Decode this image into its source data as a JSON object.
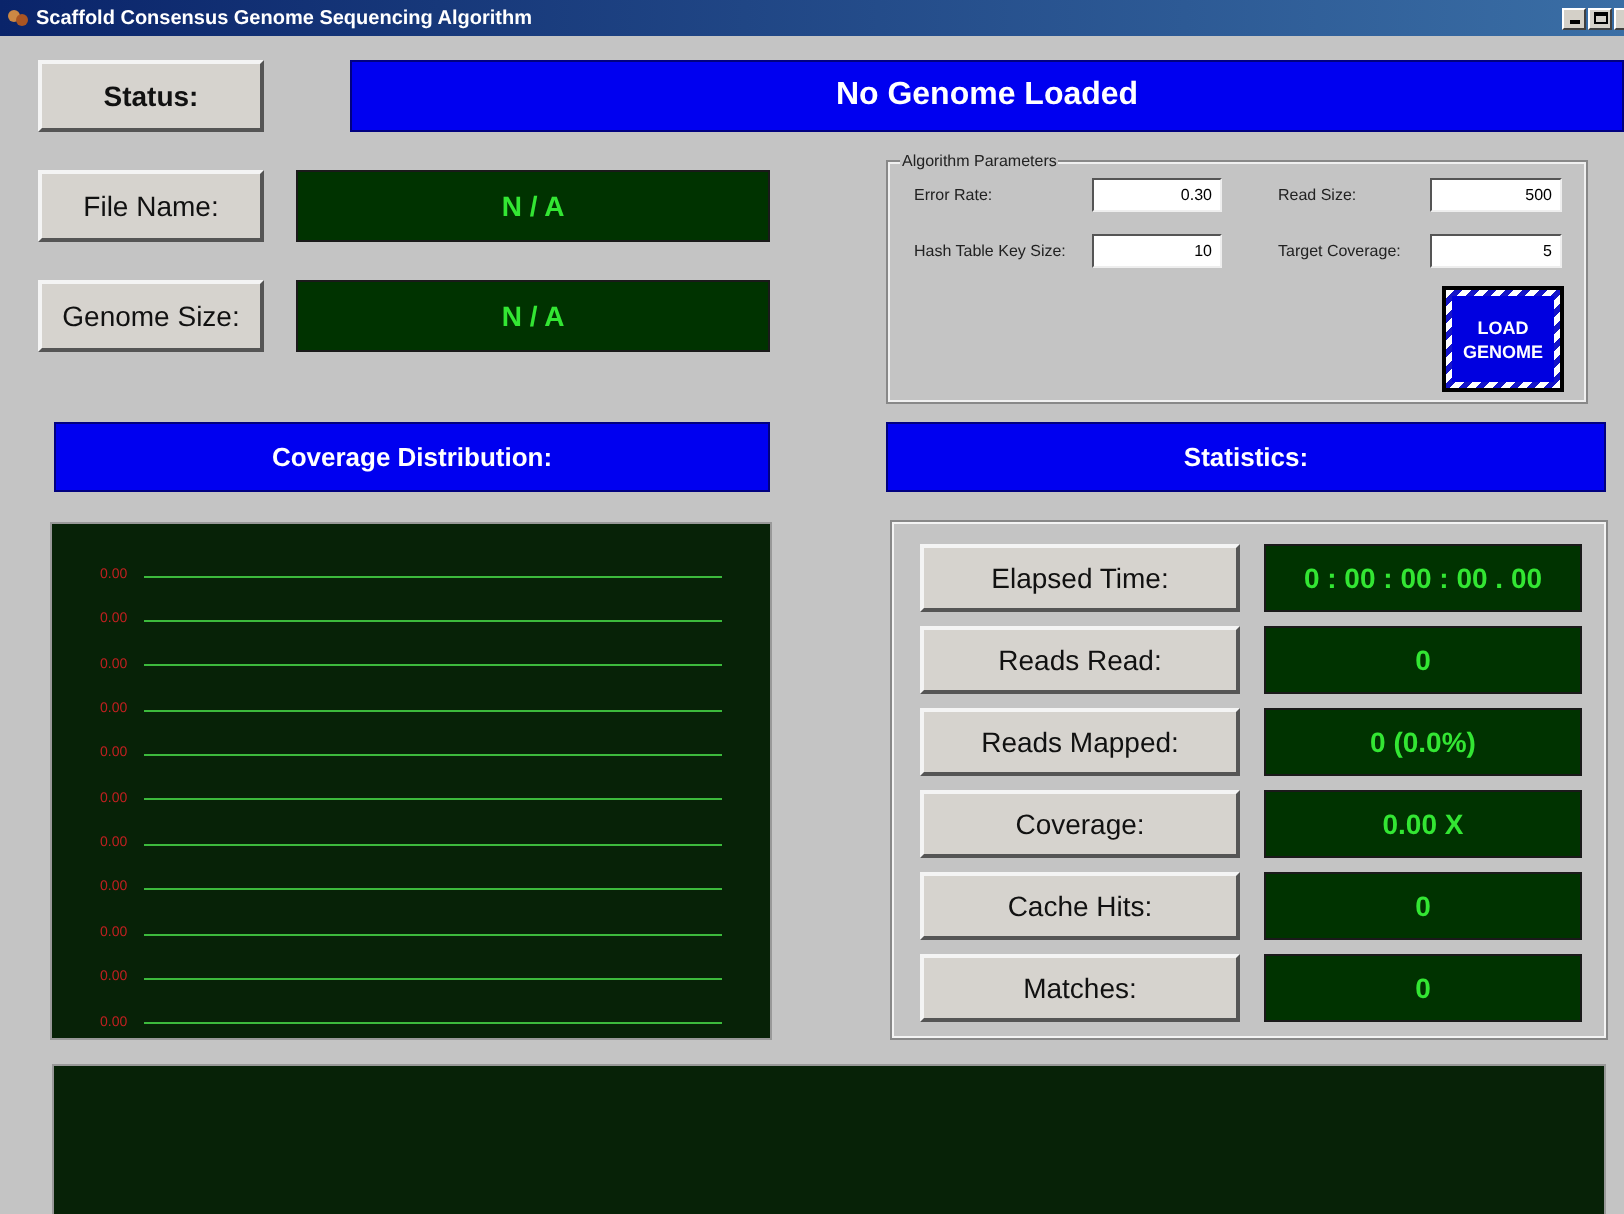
{
  "window": {
    "title": "Scaffold Consensus Genome Sequencing Algorithm"
  },
  "status": {
    "label": "Status:",
    "value": "No Genome Loaded"
  },
  "file_info": [
    {
      "label": "File Name:",
      "value": "N / A"
    },
    {
      "label": "Genome Size:",
      "value": "N / A"
    }
  ],
  "algorithm_parameters": {
    "title": "Algorithm Parameters",
    "fields": [
      {
        "label": "Error Rate:",
        "value": "0.30"
      },
      {
        "label": "Read Size:",
        "value": "500"
      },
      {
        "label": "Hash Table Key Size:",
        "value": "10"
      },
      {
        "label": "Target Coverage:",
        "value": "5"
      }
    ],
    "button": "LOAD GENOME"
  },
  "coverage_distribution": {
    "title": "Coverage Distribution:",
    "rows": [
      "0.00",
      "0.00",
      "0.00",
      "0.00",
      "0.00",
      "0.00",
      "0.00",
      "0.00",
      "0.00",
      "0.00",
      "0.00"
    ]
  },
  "statistics": {
    "title": "Statistics:",
    "rows": [
      {
        "label": "Elapsed Time:",
        "value": "0 : 00 : 00 : 00 . 00"
      },
      {
        "label": "Reads Read:",
        "value": "0"
      },
      {
        "label": "Reads Mapped:",
        "value": "0 (0.0%)"
      },
      {
        "label": "Coverage:",
        "value": "0.00 X"
      },
      {
        "label": "Cache Hits:",
        "value": "0"
      },
      {
        "label": "Matches:",
        "value": "0"
      }
    ]
  }
}
